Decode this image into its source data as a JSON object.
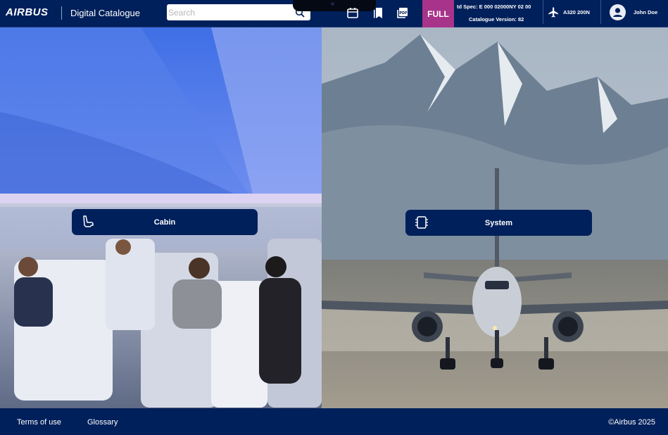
{
  "header": {
    "logo": "AIRBUS",
    "app_title": "Digital Catalogue",
    "search_placeholder": "Search",
    "mode_badge": "FULL",
    "spec_text": "td Spec: E 000 02000NY 02 00",
    "catalogue_version": "Catalogue Version: 82",
    "aircraft": "A320 200N",
    "user_name": "John Doe",
    "icons": [
      "calendar-icon",
      "bookmarks-icon",
      "pdf-icon",
      "airplane-icon",
      "user-avatar-icon"
    ]
  },
  "panels": {
    "cabin": {
      "label": "Cabin",
      "icon": "seat-icon"
    },
    "system": {
      "label": "System",
      "icon": "chip-icon"
    }
  },
  "footer": {
    "terms": "Terms of use",
    "glossary": "Glossary",
    "copyright": "©Airbus 2025"
  },
  "colors": {
    "brand_navy": "#00205b",
    "badge_magenta": "#a7348a"
  }
}
